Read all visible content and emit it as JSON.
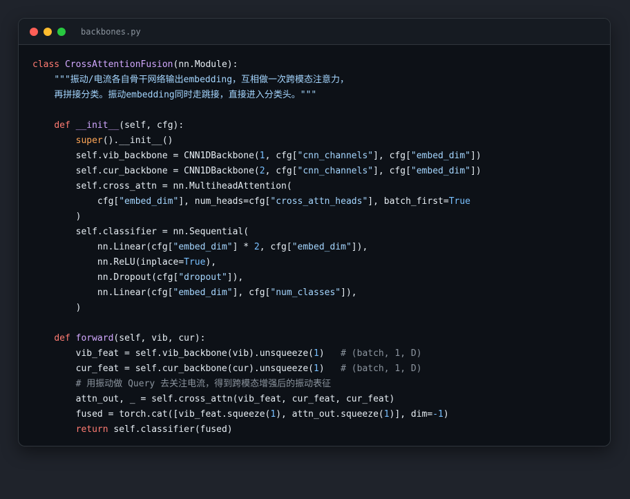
{
  "window": {
    "filename": "backbones.py",
    "colors": {
      "background": "#0d1117",
      "keyword": "#ff7b72",
      "function": "#d2a8ff",
      "string": "#a5d6ff",
      "number": "#79c0ff",
      "comment": "#8b949e"
    }
  },
  "code": [
    [
      [
        "kw",
        "class "
      ],
      [
        "fn",
        "CrossAttentionFusion"
      ],
      [
        "plain",
        "(nn.Module):"
      ]
    ],
    [
      [
        "plain",
        "    "
      ],
      [
        "str",
        "\"\"\"振动/电流各自骨干网络输出embedding，互相做一次跨模态注意力，"
      ]
    ],
    [
      [
        "plain",
        "    "
      ],
      [
        "str",
        "再拼接分类。振动embedding同时走跳接，直接进入分类头。\"\"\""
      ]
    ],
    [],
    [
      [
        "plain",
        "    "
      ],
      [
        "kw",
        "def "
      ],
      [
        "fn",
        "__init__"
      ],
      [
        "plain",
        "(self, cfg):"
      ]
    ],
    [
      [
        "plain",
        "        "
      ],
      [
        "builtin",
        "super"
      ],
      [
        "plain",
        "().__init__()"
      ]
    ],
    [
      [
        "plain",
        "        self.vib_backbone = CNN1DBackbone("
      ],
      [
        "num",
        "1"
      ],
      [
        "plain",
        ", cfg["
      ],
      [
        "str",
        "\"cnn_channels\""
      ],
      [
        "plain",
        "], cfg["
      ],
      [
        "str",
        "\"embed_dim\""
      ],
      [
        "plain",
        "])"
      ]
    ],
    [
      [
        "plain",
        "        self.cur_backbone = CNN1DBackbone("
      ],
      [
        "num",
        "2"
      ],
      [
        "plain",
        ", cfg["
      ],
      [
        "str",
        "\"cnn_channels\""
      ],
      [
        "plain",
        "], cfg["
      ],
      [
        "str",
        "\"embed_dim\""
      ],
      [
        "plain",
        "])"
      ]
    ],
    [
      [
        "plain",
        "        self.cross_attn = nn.MultiheadAttention("
      ]
    ],
    [
      [
        "plain",
        "            cfg["
      ],
      [
        "str",
        "\"embed_dim\""
      ],
      [
        "plain",
        "], num_heads=cfg["
      ],
      [
        "str",
        "\"cross_attn_heads\""
      ],
      [
        "plain",
        "], batch_first="
      ],
      [
        "const",
        "True"
      ]
    ],
    [
      [
        "plain",
        "        )"
      ]
    ],
    [
      [
        "plain",
        "        self.classifier = nn.Sequential("
      ]
    ],
    [
      [
        "plain",
        "            nn.Linear(cfg["
      ],
      [
        "str",
        "\"embed_dim\""
      ],
      [
        "plain",
        "] * "
      ],
      [
        "num",
        "2"
      ],
      [
        "plain",
        ", cfg["
      ],
      [
        "str",
        "\"embed_dim\""
      ],
      [
        "plain",
        "]),"
      ]
    ],
    [
      [
        "plain",
        "            nn.ReLU(inplace="
      ],
      [
        "const",
        "True"
      ],
      [
        "plain",
        "),"
      ]
    ],
    [
      [
        "plain",
        "            nn.Dropout(cfg["
      ],
      [
        "str",
        "\"dropout\""
      ],
      [
        "plain",
        "]),"
      ]
    ],
    [
      [
        "plain",
        "            nn.Linear(cfg["
      ],
      [
        "str",
        "\"embed_dim\""
      ],
      [
        "plain",
        "], cfg["
      ],
      [
        "str",
        "\"num_classes\""
      ],
      [
        "plain",
        "]),"
      ]
    ],
    [
      [
        "plain",
        "        )"
      ]
    ],
    [],
    [
      [
        "plain",
        "    "
      ],
      [
        "kw",
        "def "
      ],
      [
        "fn",
        "forward"
      ],
      [
        "plain",
        "(self, vib, cur):"
      ]
    ],
    [
      [
        "plain",
        "        vib_feat = self.vib_backbone(vib).unsqueeze("
      ],
      [
        "num",
        "1"
      ],
      [
        "plain",
        ")   "
      ],
      [
        "com",
        "# (batch, 1, D)"
      ]
    ],
    [
      [
        "plain",
        "        cur_feat = self.cur_backbone(cur).unsqueeze("
      ],
      [
        "num",
        "1"
      ],
      [
        "plain",
        ")   "
      ],
      [
        "com",
        "# (batch, 1, D)"
      ]
    ],
    [
      [
        "plain",
        "        "
      ],
      [
        "com",
        "# 用振动做 Query 去关注电流，得到跨模态增强后的振动表征"
      ]
    ],
    [
      [
        "plain",
        "        attn_out, _ = self.cross_attn(vib_feat, cur_feat, cur_feat)"
      ]
    ],
    [
      [
        "plain",
        "        fused = torch.cat([vib_feat.squeeze("
      ],
      [
        "num",
        "1"
      ],
      [
        "plain",
        "), attn_out.squeeze("
      ],
      [
        "num",
        "1"
      ],
      [
        "plain",
        ")], dim="
      ],
      [
        "num",
        "-1"
      ],
      [
        "plain",
        ")"
      ]
    ],
    [
      [
        "plain",
        "        "
      ],
      [
        "kw",
        "return "
      ],
      [
        "plain",
        "self.classifier(fused)"
      ]
    ]
  ]
}
